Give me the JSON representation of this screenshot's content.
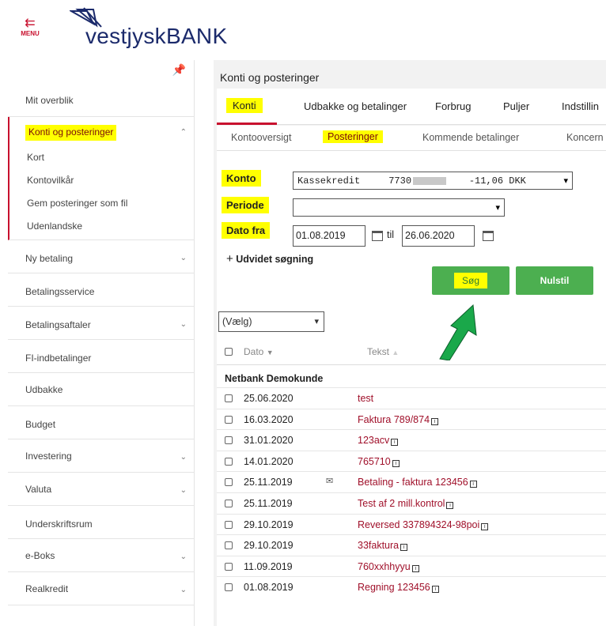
{
  "header": {
    "menu_label": "MENU",
    "logo_text_vestjysk": "vestjysk",
    "logo_text_bank": "BANK"
  },
  "sidebar": {
    "items": [
      {
        "label": "Mit overblik"
      },
      {
        "label": "Ny betaling"
      },
      {
        "label": "Betalingsservice"
      },
      {
        "label": "Betalingsaftaler"
      },
      {
        "label": "FI-indbetalinger"
      },
      {
        "label": "Udbakke"
      },
      {
        "label": "Budget"
      },
      {
        "label": "Investering"
      },
      {
        "label": "Valuta"
      },
      {
        "label": "Underskriftsrum"
      },
      {
        "label": "e-Boks"
      },
      {
        "label": "Realkredit"
      }
    ],
    "expanded": {
      "label": "Konti og posteringer",
      "sub_items": [
        "Kort",
        "Kontovilkår",
        "Gem posteringer som fil",
        "Udenlandske"
      ]
    }
  },
  "main": {
    "title": "Konti og posteringer",
    "tabs": [
      "Konti",
      "Udbakke og betalinger",
      "Forbrug",
      "Puljer",
      "Indstillin"
    ],
    "subtabs": [
      "Kontooversigt",
      "Posteringer",
      "Kommende betalinger",
      "Koncern"
    ],
    "form": {
      "konto_label": "Konto",
      "konto_value_name": "Kassekredit",
      "konto_value_num": "7730",
      "konto_value_amount": "-11,06 DKK",
      "periode_label": "Periode",
      "periode_value": "",
      "dato_fra_label": "Dato fra",
      "date_from": "01.08.2019",
      "til_label": "til",
      "date_to": "26.06.2020",
      "expand_label": "Udvidet søgning",
      "search_button": "Søg",
      "reset_button": "Nulstil"
    },
    "list": {
      "select_value": "(Vælg)",
      "col_date": "Dato",
      "col_text": "Tekst",
      "group": "Netbank Demokunde",
      "rows": [
        {
          "date": "25.06.2020",
          "text": "test",
          "info": false,
          "mail": false
        },
        {
          "date": "16.03.2020",
          "text": "Faktura 789/874",
          "info": true,
          "mail": false
        },
        {
          "date": "31.01.2020",
          "text": "123acv",
          "info": true,
          "mail": false
        },
        {
          "date": "14.01.2020",
          "text": "765710",
          "info": true,
          "mail": false
        },
        {
          "date": "25.11.2019",
          "text": "Betaling - faktura 123456",
          "info": true,
          "mail": true
        },
        {
          "date": "25.11.2019",
          "text": "Test af 2 mill.kontrol",
          "info": true,
          "mail": false
        },
        {
          "date": "29.10.2019",
          "text": "Reversed 337894324-98poi",
          "info": true,
          "mail": false
        },
        {
          "date": "29.10.2019",
          "text": "33faktura",
          "info": true,
          "mail": false
        },
        {
          "date": "11.09.2019",
          "text": "760xxhhyyu",
          "info": true,
          "mail": false
        },
        {
          "date": "01.08.2019",
          "text": "Regning 123456",
          "info": true,
          "mail": false
        }
      ]
    }
  },
  "colors": {
    "brand_red": "#c8102e",
    "brand_navy": "#1b2a6b",
    "button_green": "#4caf50",
    "highlight_yellow": "#ffff00"
  }
}
